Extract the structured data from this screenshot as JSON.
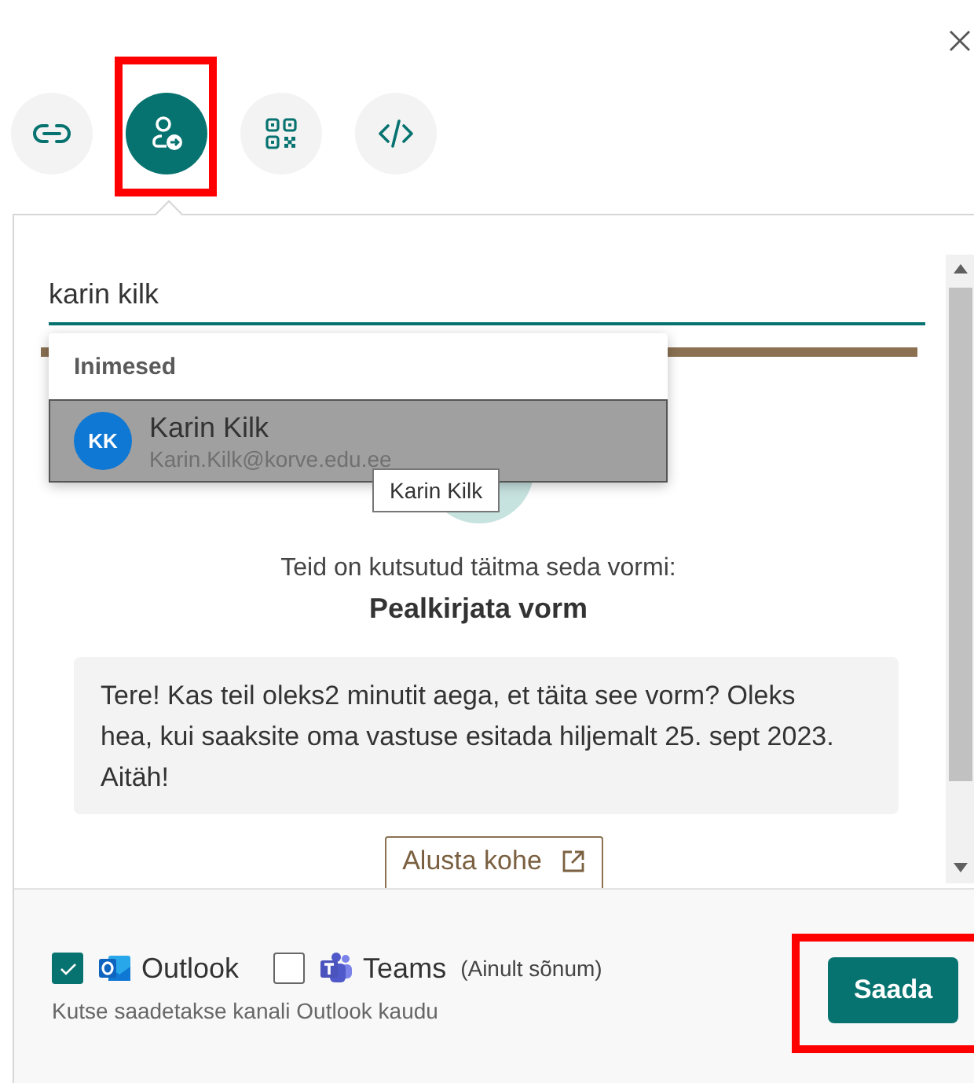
{
  "tabs": [
    {
      "kind": "link",
      "selected": false,
      "highlighted": false
    },
    {
      "kind": "invite",
      "selected": true,
      "highlighted": true
    },
    {
      "kind": "qr",
      "selected": false,
      "highlighted": false
    },
    {
      "kind": "embed",
      "selected": false,
      "highlighted": false
    }
  ],
  "search": {
    "value": "karin kilk"
  },
  "people_dropdown": {
    "heading": "Inimesed",
    "results": [
      {
        "initials": "KK",
        "name": "Karin Kilk",
        "email": "Karin.Kilk@korve.edu.ee",
        "selected": true
      }
    ]
  },
  "tooltip": "Karin Kilk",
  "preview": {
    "invitation": "Teid on kutsutud täitma seda vormi:",
    "form_title": "Pealkirjata vorm",
    "message": "Tere! Kas teil oleks2 minutit aega, et täita see vorm? Oleks hea, kui saaksite oma vastuse esitada hiljemalt 25. sept 2023. Aitäh!",
    "start_button": "Alusta kohe"
  },
  "channels": [
    {
      "kind": "outlook",
      "label": "Outlook",
      "checked": true
    },
    {
      "kind": "teams",
      "label": "Teams",
      "note": "(Ainult sõnum)",
      "checked": false
    }
  ],
  "channel_hint": "Kutse saadetakse kanali Outlook kaudu",
  "send_button": {
    "label": "Saada",
    "highlighted": true
  }
}
